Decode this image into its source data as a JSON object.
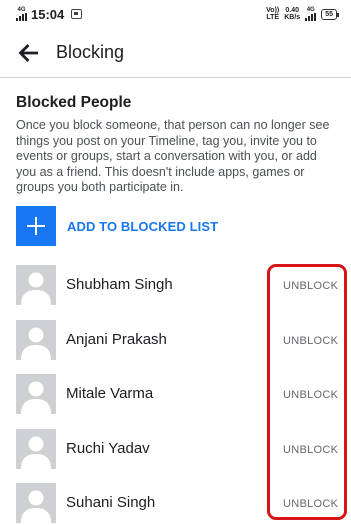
{
  "status_bar": {
    "network_left": "4G",
    "time": "15:04",
    "volte_top": "Vo))",
    "volte_bottom": "LTE",
    "speed_top": "0.40",
    "speed_bottom": "KB/s",
    "network_right": "4G",
    "battery": "55"
  },
  "header": {
    "title": "Blocking",
    "back_icon": "arrow-left-icon"
  },
  "blocked_section": {
    "title": "Blocked People",
    "description": "Once you block someone, that person can no longer see things you post on your Timeline, tag you, invite you to events or groups, start a conversation with you, or add you as a friend. This doesn't include apps, games or groups you both participate in.",
    "add_label": "ADD TO BLOCKED LIST",
    "add_icon": "plus-icon"
  },
  "blocked_people": [
    {
      "name": "Shubham Singh",
      "action": "UNBLOCK"
    },
    {
      "name": "Anjani Prakash",
      "action": "UNBLOCK"
    },
    {
      "name": "Mitale Varma",
      "action": "UNBLOCK"
    },
    {
      "name": "Ruchi Yadav",
      "action": "UNBLOCK"
    },
    {
      "name": "Suhani Singh",
      "action": "UNBLOCK"
    }
  ],
  "colors": {
    "accent": "#1877f2",
    "highlight": "#d8141b",
    "avatar_bg": "#ced0d4"
  }
}
